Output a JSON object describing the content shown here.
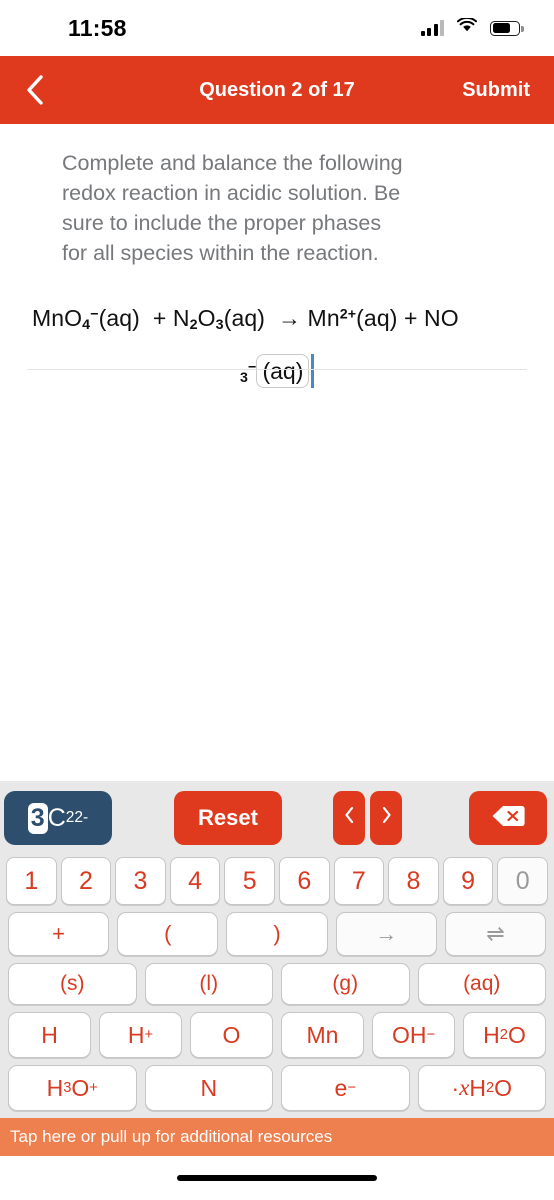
{
  "statusbar": {
    "time": "11:58",
    "signal_icon": "cellular-signal-icon",
    "wifi_icon": "wifi-icon",
    "battery_icon": "battery-icon"
  },
  "navbar": {
    "back_icon": "chevron-left-icon",
    "title": "Question 2 of 17",
    "submit_label": "Submit"
  },
  "question": {
    "prompt": "Complete and balance the following redox reaction in acidic solution. Be sure to include the proper phases for all species within the reaction.",
    "equation_line1": "MnO₄⁻(aq) + N₂O₃(aq) → Mn²⁺(aq) + NO",
    "equation_line2": "₃⁻(aq)",
    "answer_token": "(aq)",
    "caret_visible": true
  },
  "keyboard": {
    "tools": {
      "coefficient_selector": {
        "name": "coefficient-subscript-superscript-selector",
        "coefficient": "3",
        "element": "C",
        "subscript": "2",
        "superscript": "2-",
        "active_part": "coefficient",
        "bg_color": "#2d4f6d"
      },
      "reset_label": "Reset",
      "prev_icon": "chevron-left-icon",
      "next_icon": "chevron-right-icon",
      "delete_icon": "backspace-icon",
      "accent_color": "#e03a1e"
    },
    "numbers": [
      {
        "label": "1",
        "disabled": false
      },
      {
        "label": "2",
        "disabled": false
      },
      {
        "label": "3",
        "disabled": false
      },
      {
        "label": "4",
        "disabled": false
      },
      {
        "label": "5",
        "disabled": false
      },
      {
        "label": "6",
        "disabled": false
      },
      {
        "label": "7",
        "disabled": false
      },
      {
        "label": "8",
        "disabled": false
      },
      {
        "label": "9",
        "disabled": false
      },
      {
        "label": "0",
        "disabled": true
      }
    ],
    "symbols": [
      {
        "label": "+",
        "disabled": false
      },
      {
        "label": "(",
        "disabled": false
      },
      {
        "label": ")",
        "disabled": false
      },
      {
        "label": "→",
        "disabled": true
      },
      {
        "label": "⇌",
        "disabled": true
      }
    ],
    "phases": [
      {
        "label": "(s)",
        "disabled": false
      },
      {
        "label": "(l)",
        "disabled": false
      },
      {
        "label": "(g)",
        "disabled": false
      },
      {
        "label": "(aq)",
        "disabled": false
      }
    ],
    "species_row1": [
      {
        "label": "H",
        "disabled": false
      },
      {
        "label": "H⁺",
        "disabled": false
      },
      {
        "label": "O",
        "disabled": false
      },
      {
        "label": "Mn",
        "disabled": false
      },
      {
        "label": "OH⁻",
        "disabled": false
      },
      {
        "label": "H₂O",
        "disabled": false
      }
    ],
    "species_row2": [
      {
        "label": "H₃O⁺",
        "disabled": false
      },
      {
        "label": "N",
        "disabled": false
      },
      {
        "label": "e⁻",
        "disabled": false
      },
      {
        "label": "· 𝑥 H₂O",
        "disabled": false
      }
    ]
  },
  "footer": {
    "resources_label": "Tap here or pull up for additional resources",
    "resources_color": "#ee7f4e",
    "home_indicator": "home-indicator"
  }
}
